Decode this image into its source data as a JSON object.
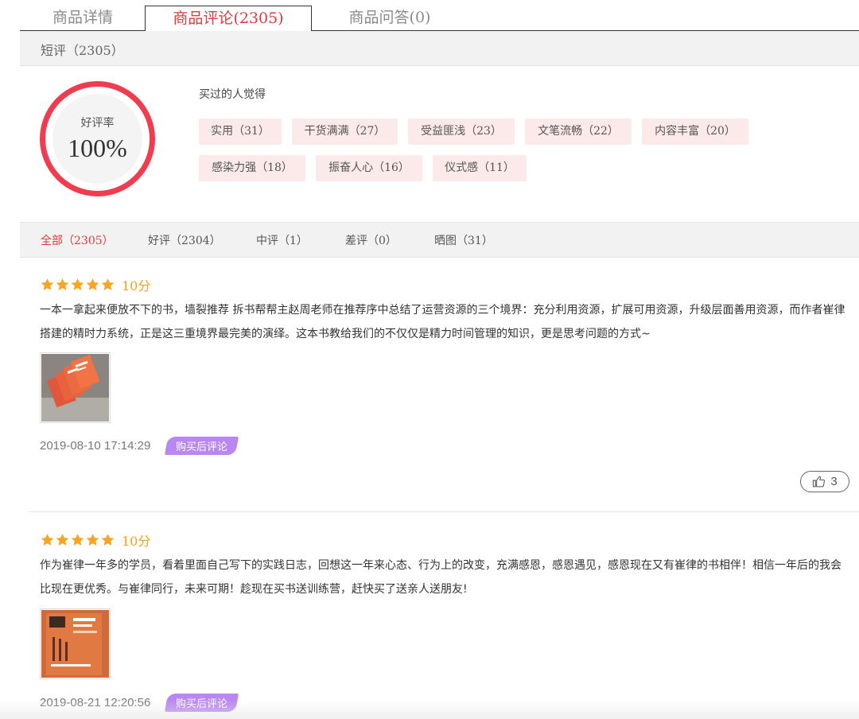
{
  "tabs": [
    {
      "label": "商品详情"
    },
    {
      "label": "商品评论(2305)"
    },
    {
      "label": "商品问答(0)"
    }
  ],
  "short_review": {
    "label": "短评（2305）"
  },
  "rating": {
    "label": "好评率",
    "value": "100%",
    "ring_color": "#f03c4f"
  },
  "buyers": {
    "title": "买过的人觉得",
    "tags": [
      {
        "label": "实用（31）"
      },
      {
        "label": "干货满满（27）"
      },
      {
        "label": "受益匪浅（23）"
      },
      {
        "label": "文笔流畅（22）"
      },
      {
        "label": "内容丰富（20）"
      },
      {
        "label": "感染力强（18）"
      },
      {
        "label": "振奋人心（16）"
      },
      {
        "label": "仪式感（11）"
      }
    ]
  },
  "filters": [
    {
      "label": "全部（2305）",
      "active": true
    },
    {
      "label": "好评（2304）"
    },
    {
      "label": "中评（1）"
    },
    {
      "label": "差评（0）"
    },
    {
      "label": "晒图（31）"
    }
  ],
  "reviews": [
    {
      "stars": 5,
      "score": "10分",
      "text": "一本一拿起来便放不下的书，墙裂推荐 拆书帮帮主赵周老师在推荐序中总结了运营资源的三个境界：充分利用资源，扩展可用资源，升级层面善用资源，而作者崔律搭建的精时力系统，正是这三重境界最完美的演绎。这本书教给我们的不仅仅是精力时间管理的知识，更是思考问题的方式~",
      "date": "2019-08-10 17:14:29",
      "badge": "购买后评论",
      "likes": "3"
    },
    {
      "stars": 5,
      "score": "10分",
      "text": "作为崔律一年多的学员，看着里面自己写下的实践日志，回想这一年来心态、行为上的改变，充满感恩，感恩遇见，感恩现在又有崔律的书相伴！相信一年后的我会比现在更优秀。与崔律同行，未来可期！趁现在买书送训练营，赶快买了送亲人送朋友!",
      "date": "2019-08-21 12:20:56",
      "badge": "购买后评论"
    }
  ],
  "colors": {
    "accent": "#e4393c",
    "star": "#f5a623",
    "badge": "#b987f0",
    "tag_bg": "#fce9e9"
  }
}
